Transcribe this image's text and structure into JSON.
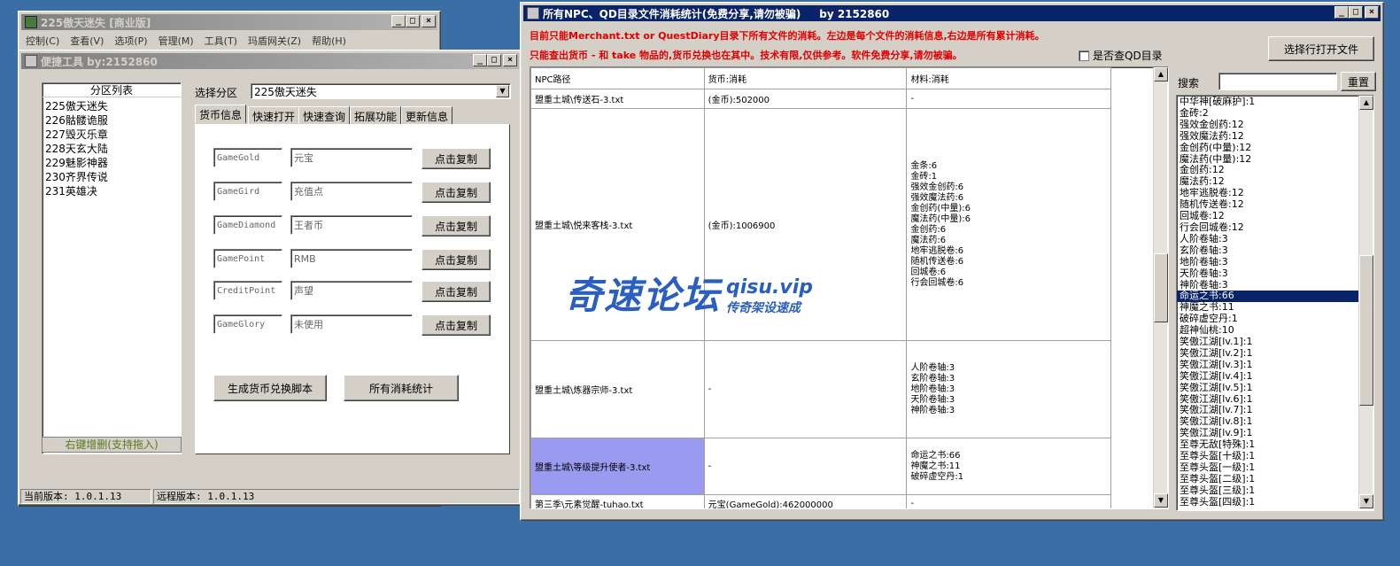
{
  "main_window": {
    "title": "225傲天迷失 [商业版]",
    "menu": [
      "控制(C)",
      "查看(V)",
      "选项(P)",
      "管理(M)",
      "工具(T)",
      "玛盾网关(Z)",
      "帮助(H)"
    ]
  },
  "tool_window": {
    "title": "便捷工具    by:2152860",
    "partition_list_header": "分区列表",
    "partitions": [
      "225傲天迷失",
      "226骷髅诡服",
      "227毁灭乐章",
      "228天玄大陆",
      "229魅影神器",
      "230齐界传说",
      "231英雄决"
    ],
    "partition_footer": "右键增删(支持拖入)",
    "select_label": "选择分区",
    "select_value": "225傲天迷失",
    "tabs": [
      "货币信息",
      "快速打开",
      "快速查询",
      "拓展功能",
      "更新信息"
    ],
    "currency_rows": [
      {
        "code": "GameGold",
        "name": "元宝",
        "button": "点击复制"
      },
      {
        "code": "GameGird",
        "name": "充值点",
        "button": "点击复制"
      },
      {
        "code": "GameDiamond",
        "name": "王者币",
        "button": "点击复制"
      },
      {
        "code": "GamePoint",
        "name": "RMB",
        "button": "点击复制"
      },
      {
        "code": "CreditPoint",
        "name": "声望",
        "button": "点击复制"
      },
      {
        "code": "GameGlory",
        "name": "未使用",
        "button": "点击复制"
      }
    ],
    "gen_script_button": "生成货币兑换脚本",
    "all_stats_button": "所有消耗统计",
    "current_version": "当前版本: 1.0.1.13",
    "remote_version": "远程版本: 1.0.1.13"
  },
  "stats_window": {
    "title": "所有NPC、QD目录文件消耗统计(免费分享,请勿被骗)     by 2152860",
    "notice1": "目前只能Merchant.txt or QuestDiary目录下所有文件的消耗。左边是每个文件的消耗信息,右边是所有累计消耗。",
    "notice2": "只能查出货币 - 和 take 物品的,货币兑换也在其中。技术有限,仅供参考。软件免费分享,请勿被骗。",
    "checkbox_label": "是否查QD目录",
    "open_file_button": "选择行打开文件",
    "search_label": "搜索",
    "search_value": "",
    "reset_button": "重置",
    "columns": [
      "NPC路径",
      "货币:消耗",
      "材料:消耗"
    ],
    "rows": [
      {
        "path": "盟重土城\\传送石-3.txt",
        "currency": "(金币):502000",
        "materials": [
          "-"
        ]
      },
      {
        "path": "盟重土城\\悦来客栈-3.txt",
        "currency": "(金币):1006900",
        "materials": [
          "金条:6",
          "金砖:1",
          "强效金创药:6",
          "强效魔法药:6",
          "金创药(中量):6",
          "魔法药(中量):6",
          "金创药:6",
          "魔法药:6",
          "地牢逃脱卷:6",
          "随机传送卷:6",
          "回城卷:6",
          "行会回城卷:6"
        ]
      },
      {
        "path": "盟重土城\\炼器宗师-3.txt",
        "currency": "-",
        "materials": [
          "人阶卷轴:3",
          "玄阶卷轴:3",
          "地阶卷轴:3",
          "天阶卷轴:3",
          "神阶卷轴:3"
        ]
      },
      {
        "path": "盟重土城\\等级提升使者-3.txt",
        "currency": "-",
        "materials": [
          "命运之书:66",
          "神魔之书:11",
          "破碎虚空丹:1"
        ]
      },
      {
        "path": "第三季\\元素觉醒-tuhao.txt",
        "currency": "元宝(GameGold):462000000",
        "materials": [
          "-"
        ]
      }
    ],
    "totals": [
      "中华神[破麻护]:1",
      "金砖:2",
      "强效金创药:12",
      "强效魔法药:12",
      "金创药(中量):12",
      "魔法药(中量):12",
      "金创药:12",
      "魔法药:12",
      "地牢逃脱卷:12",
      "随机传送卷:12",
      "回城卷:12",
      "行会回城卷:12",
      "人阶卷轴:3",
      "玄阶卷轴:3",
      "地阶卷轴:3",
      "天阶卷轴:3",
      "神阶卷轴:3",
      "命运之书:66",
      "神魔之书:11",
      "破碎虚空丹:1",
      "超神仙桃:10",
      "笑傲江湖[lv.1]:1",
      "笑傲江湖[lv.2]:1",
      "笑傲江湖[lv.3]:1",
      "笑傲江湖[lv.4]:1",
      "笑傲江湖[lv.5]:1",
      "笑傲江湖[lv.6]:1",
      "笑傲江湖[lv.7]:1",
      "笑傲江湖[lv.8]:1",
      "笑傲江湖[lv.9]:1",
      "至尊无敌[特殊]:1",
      "至尊头盔[十级]:1",
      "至尊头盔[一级]:1",
      "至尊头盔[二级]:1",
      "至尊头盔[三级]:1",
      "至尊头盔[四级]:1"
    ],
    "selected_total_index": 17
  },
  "watermark": {
    "cn": "奇速论坛",
    "url": "qisu.vip",
    "sub": "传奇架设速成"
  },
  "colors": {
    "desktop": "#3a6ea5",
    "notice_red": "#e00000",
    "selection": "#0a246a",
    "row_highlight": "#9a9af0",
    "watermark": "#2a5ec0"
  }
}
